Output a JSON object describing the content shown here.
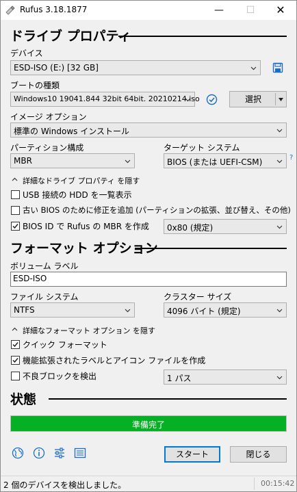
{
  "window": {
    "title": "Rufus 3.18.1877",
    "minimize": "—",
    "maximize": "☐",
    "close": "✕"
  },
  "drive_section": {
    "heading": "ドライブ プロパティ",
    "device_label": "デバイス",
    "device_value": "ESD-ISO (E:) [32 GB]",
    "boot_label": "ブートの種類",
    "boot_value": "Windows10 19041.844 32bit 64bit. 20210214.iso",
    "select_button": "選択",
    "image_option_label": "イメージ オプション",
    "image_option_value": "標準の Windows インストール",
    "partition_label": "パーティション構成",
    "partition_value": "MBR",
    "target_label": "ターゲット システム",
    "target_value": "BIOS (または UEFI-CSM)",
    "help": "?",
    "advanced_toggle": "詳細なドライブ プロパティ を隠す",
    "opt_usb_hdd": "USB 接続の HDD を一覧表示",
    "opt_old_bios": "古い BIOS のために修正を追加 (パーティションの拡張、並び替え、その他)",
    "opt_bios_id": "BIOS ID で Rufus の MBR を作成",
    "bios_id_value": "0x80 (規定)"
  },
  "format_section": {
    "heading": "フォーマット オプション",
    "volume_label": "ボリューム ラベル",
    "volume_value": "ESD-ISO",
    "fs_label": "ファイル システム",
    "fs_value": "NTFS",
    "cluster_label": "クラスター サイズ",
    "cluster_value": "4096 バイト (規定)",
    "advanced_toggle": "詳細なフォーマット オプション を隠す",
    "opt_quick": "クイック フォーマット",
    "opt_extended_label": "機能拡張されたラベルとアイコン ファイルを作成",
    "opt_bad_blocks": "不良ブロックを検出",
    "passes_value": "1 パス"
  },
  "status_section": {
    "heading": "状態",
    "progress_text": "準備完了",
    "progress_fraction": 1.0
  },
  "actions": {
    "start": "スタート",
    "close": "閉じる"
  },
  "statusbar": {
    "message": "2 個のデバイスを検出しました。",
    "time": "00:15:42"
  },
  "checkboxes": {
    "usb_hdd": false,
    "old_bios": false,
    "bios_id": true,
    "quick": true,
    "extended_label": true,
    "bad_blocks": false
  },
  "icons": [
    "app-icon",
    "save-icon",
    "checkmark-circle-icon",
    "split-arrow-icon",
    "globe-icon",
    "info-icon",
    "settings-sliders-icon",
    "log-icon",
    "chevron-down-icon",
    "chevron-up-icon"
  ],
  "colors": {
    "progress": "#06b025",
    "accent": "#0078d7",
    "icon": "#1a6fc4"
  }
}
